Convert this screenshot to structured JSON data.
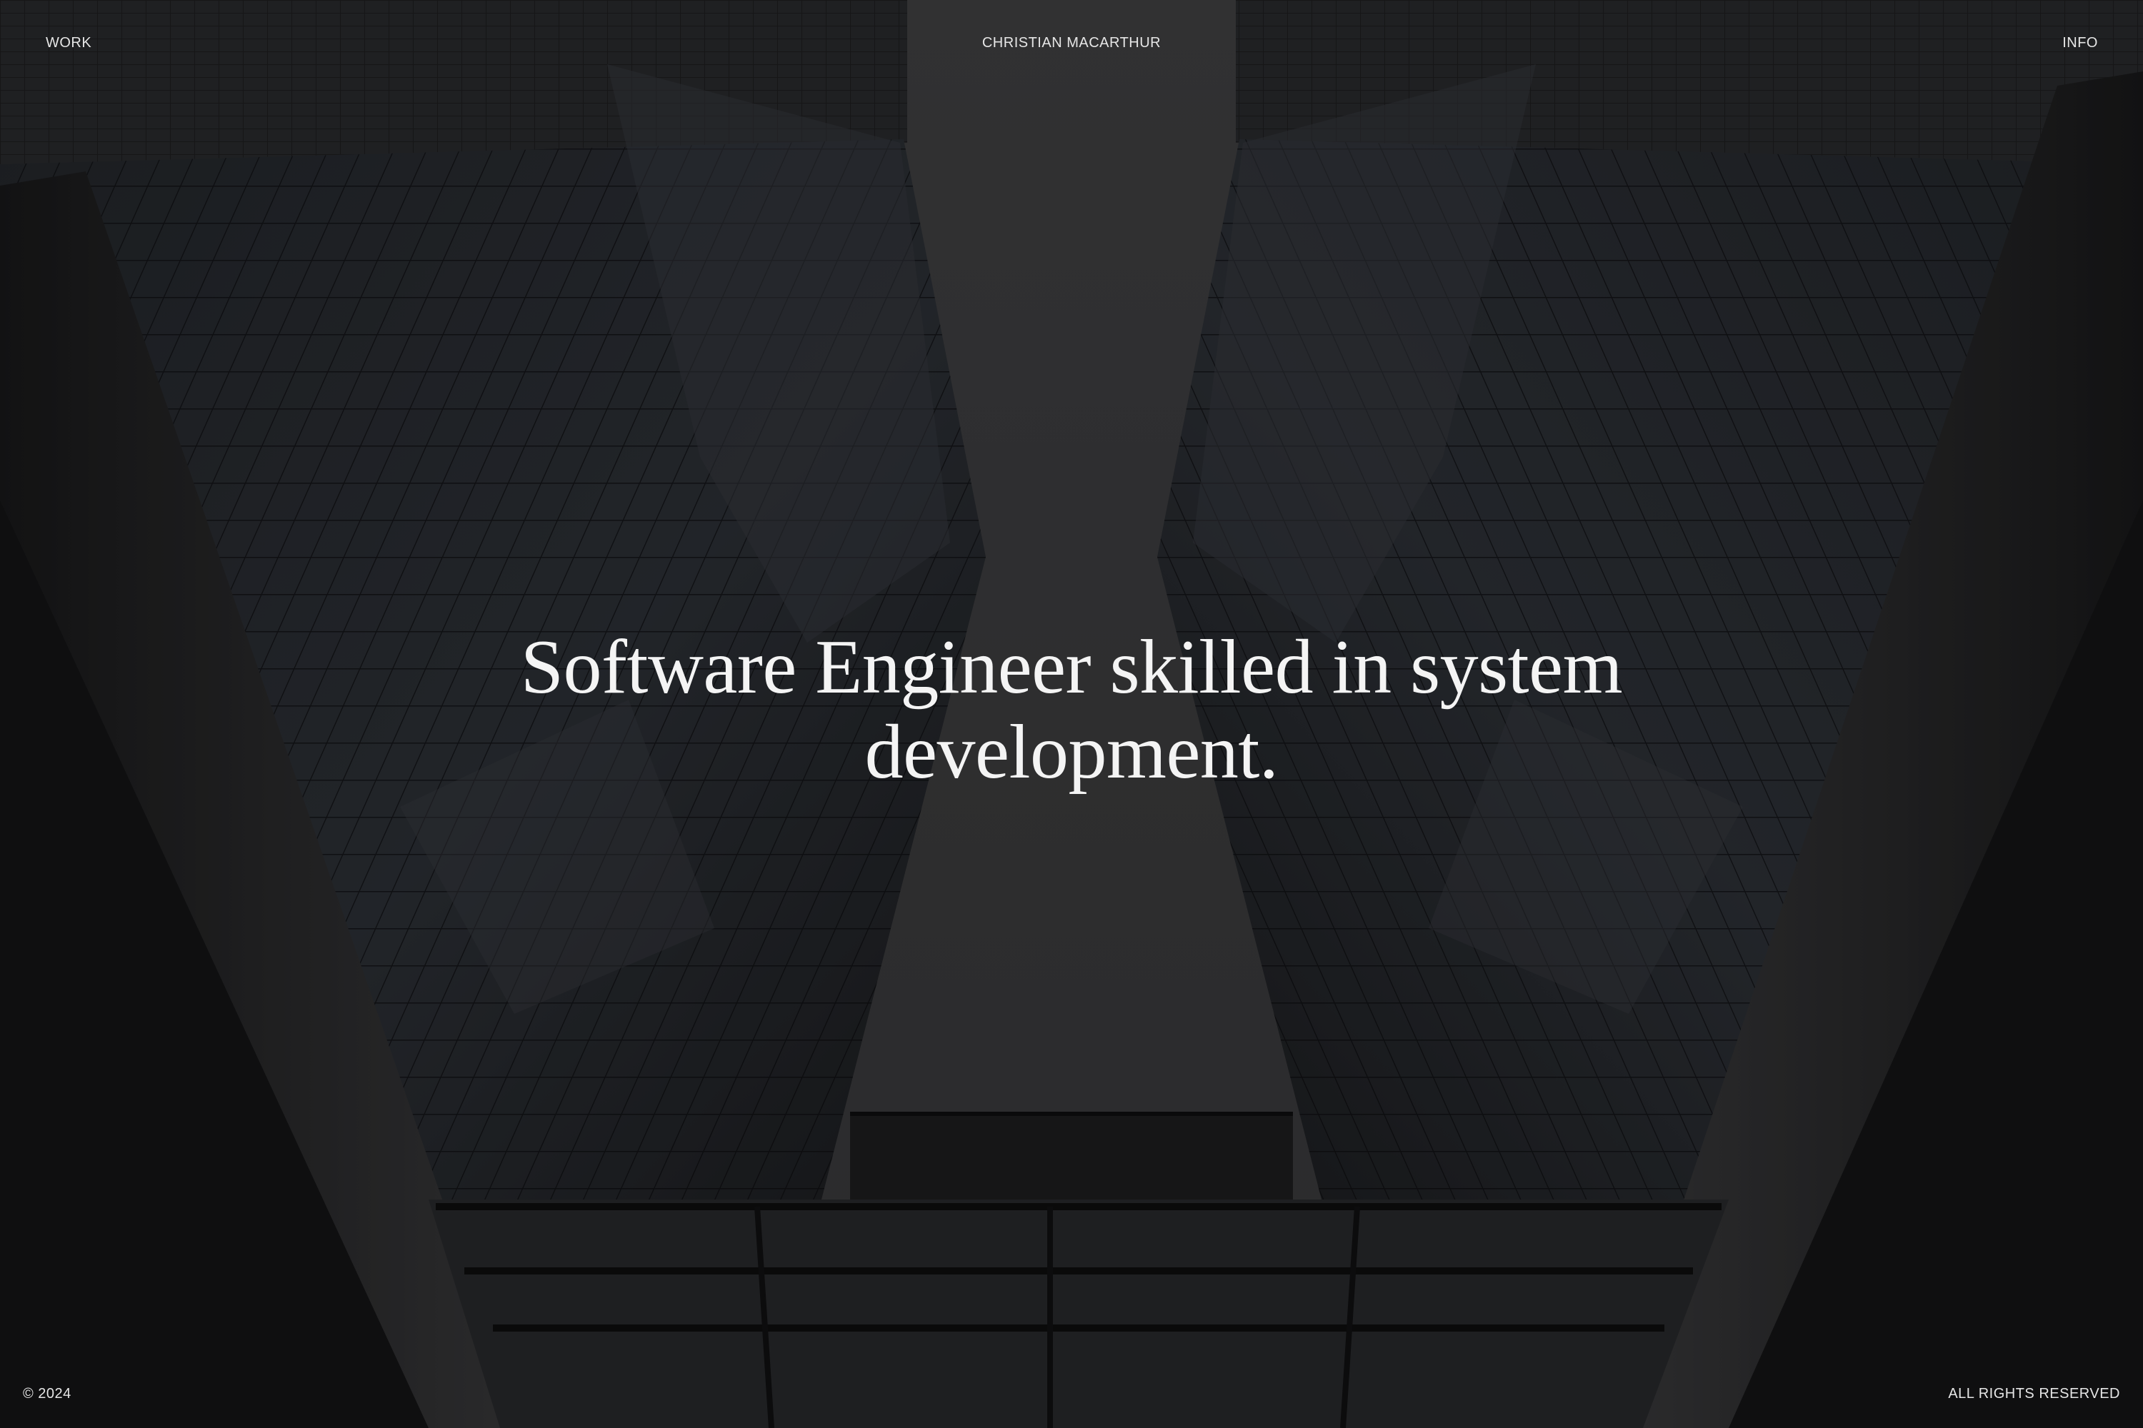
{
  "header": {
    "nav_left": "WORK",
    "site_title": "CHRISTIAN MACARTHUR",
    "nav_right": "INFO"
  },
  "hero": {
    "headline_line1": "Software Engineer skilled in system",
    "headline_line2": "development."
  },
  "footer": {
    "copyright": "© 2024",
    "rights": "ALL RIGHTS RESERVED"
  },
  "colors": {
    "text": "#e6e6e6",
    "sky": "#4a4a4c",
    "overlay": "#000000"
  }
}
